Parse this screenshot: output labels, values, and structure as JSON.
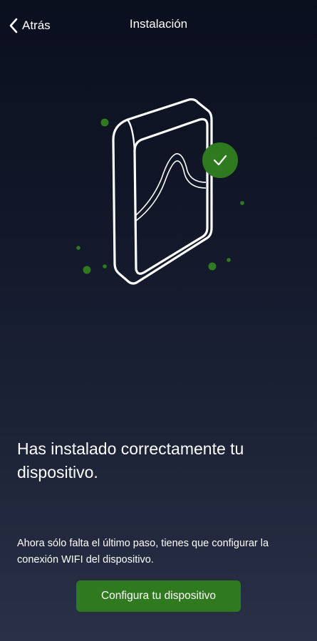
{
  "header": {
    "back_label": "Atrás",
    "title": "Instalación"
  },
  "illustration": {
    "icon": "device-installed-check",
    "accent_color": "#2f7a1f"
  },
  "content": {
    "headline": "Has instalado correctamente tu dispositivo.",
    "description": "Ahora sólo falta el último paso, tienes que configurar la conexión WIFI del dispositivo."
  },
  "cta": {
    "label": "Configura tu dispositivo",
    "color": "#2f7a1f"
  }
}
